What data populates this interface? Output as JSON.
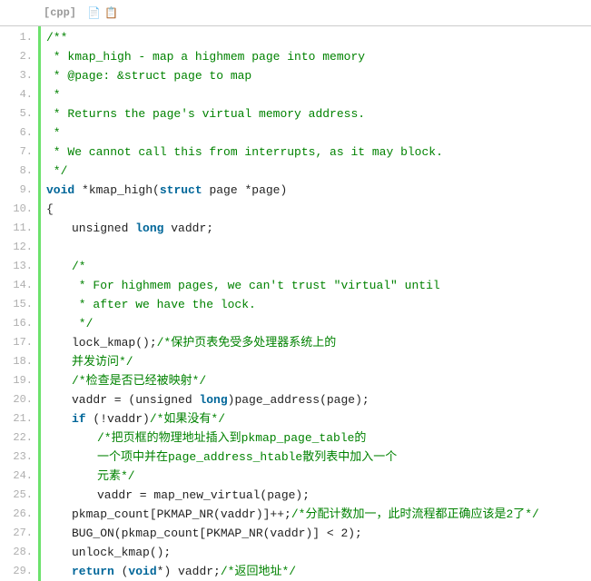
{
  "header": {
    "lang": "[cpp]",
    "icon1": "📄",
    "icon2": "📋"
  },
  "lines": [
    {
      "n": "1.",
      "seg": [
        {
          "c": "cm",
          "t": "/**"
        }
      ]
    },
    {
      "n": "2.",
      "seg": [
        {
          "c": "cm",
          "t": " * kmap_high - map a highmem page into memory"
        }
      ]
    },
    {
      "n": "3.",
      "seg": [
        {
          "c": "cm",
          "t": " * @page: &struct page to map"
        }
      ]
    },
    {
      "n": "4.",
      "seg": [
        {
          "c": "cm",
          "t": " *"
        }
      ]
    },
    {
      "n": "5.",
      "seg": [
        {
          "c": "cm",
          "t": " * Returns the page's virtual memory address."
        }
      ]
    },
    {
      "n": "6.",
      "seg": [
        {
          "c": "cm",
          "t": " *"
        }
      ]
    },
    {
      "n": "7.",
      "seg": [
        {
          "c": "cm",
          "t": " * We cannot call this from interrupts, as it may block."
        }
      ]
    },
    {
      "n": "8.",
      "seg": [
        {
          "c": "cm",
          "t": " */"
        }
      ]
    },
    {
      "n": "9.",
      "seg": [
        {
          "c": "kw",
          "t": "void"
        },
        {
          "c": "pl",
          "t": " *kmap_high("
        },
        {
          "c": "kw",
          "t": "struct"
        },
        {
          "c": "pl",
          "t": " page *page)"
        }
      ]
    },
    {
      "n": "10.",
      "seg": [
        {
          "c": "pl",
          "t": "{"
        }
      ]
    },
    {
      "n": "11.",
      "ind": 1,
      "seg": [
        {
          "c": "pl",
          "t": "unsigned "
        },
        {
          "c": "kw",
          "t": "long"
        },
        {
          "c": "pl",
          "t": " vaddr;"
        }
      ]
    },
    {
      "n": "12.",
      "seg": []
    },
    {
      "n": "13.",
      "ind": 1,
      "seg": [
        {
          "c": "cm",
          "t": "/*"
        }
      ]
    },
    {
      "n": "14.",
      "ind": 1,
      "seg": [
        {
          "c": "cm",
          "t": " * For highmem pages, we can't trust \"virtual\" until"
        }
      ]
    },
    {
      "n": "15.",
      "ind": 1,
      "seg": [
        {
          "c": "cm",
          "t": " * after we have the lock."
        }
      ]
    },
    {
      "n": "16.",
      "ind": 1,
      "seg": [
        {
          "c": "cm",
          "t": " */"
        }
      ]
    },
    {
      "n": "17.",
      "ind": 1,
      "seg": [
        {
          "c": "pl",
          "t": "lock_kmap();"
        },
        {
          "c": "cm",
          "t": "/*保护页表免受多处理器系统上的"
        }
      ]
    },
    {
      "n": "18.",
      "ind": 1,
      "seg": [
        {
          "c": "cm",
          "t": "并发访问*/"
        }
      ]
    },
    {
      "n": "19.",
      "ind": 1,
      "seg": [
        {
          "c": "cm",
          "t": "/*检查是否已经被映射*/"
        }
      ]
    },
    {
      "n": "20.",
      "ind": 1,
      "seg": [
        {
          "c": "pl",
          "t": "vaddr = (unsigned "
        },
        {
          "c": "kw",
          "t": "long"
        },
        {
          "c": "pl",
          "t": ")page_address(page);"
        }
      ]
    },
    {
      "n": "21.",
      "ind": 1,
      "seg": [
        {
          "c": "kw",
          "t": "if"
        },
        {
          "c": "pl",
          "t": " (!vaddr)"
        },
        {
          "c": "cm",
          "t": "/*如果没有*/"
        }
      ]
    },
    {
      "n": "22.",
      "ind": 2,
      "seg": [
        {
          "c": "cm",
          "t": "/*把页框的物理地址插入到pkmap_page_table的"
        }
      ]
    },
    {
      "n": "23.",
      "ind": 2,
      "seg": [
        {
          "c": "cm",
          "t": "一个项中并在page_address_htable散列表中加入一个"
        }
      ]
    },
    {
      "n": "24.",
      "ind": 2,
      "seg": [
        {
          "c": "cm",
          "t": "元素*/"
        }
      ]
    },
    {
      "n": "25.",
      "ind": 2,
      "seg": [
        {
          "c": "pl",
          "t": "vaddr = map_new_virtual(page);"
        }
      ]
    },
    {
      "n": "26.",
      "ind": 1,
      "seg": [
        {
          "c": "pl",
          "t": "pkmap_count[PKMAP_NR(vaddr)]++;"
        },
        {
          "c": "cm",
          "t": "/*分配计数加一，此时流程都正确应该是2了*/"
        }
      ]
    },
    {
      "n": "27.",
      "ind": 1,
      "seg": [
        {
          "c": "pl",
          "t": "BUG_ON(pkmap_count[PKMAP_NR(vaddr)] < 2);"
        }
      ]
    },
    {
      "n": "28.",
      "ind": 1,
      "seg": [
        {
          "c": "pl",
          "t": "unlock_kmap();"
        }
      ]
    },
    {
      "n": "29.",
      "ind": 1,
      "seg": [
        {
          "c": "kw",
          "t": "return"
        },
        {
          "c": "pl",
          "t": " ("
        },
        {
          "c": "kw",
          "t": "void"
        },
        {
          "c": "pl",
          "t": "*) vaddr;"
        },
        {
          "c": "cm",
          "t": "/*返回地址*/"
        }
      ]
    }
  ]
}
